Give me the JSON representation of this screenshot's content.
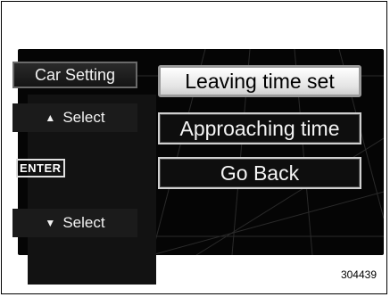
{
  "sidebar": {
    "title": "Car Setting",
    "select_up": "Select",
    "enter": "ENTER",
    "select_down": "Select"
  },
  "menu": {
    "items": [
      {
        "label": "Leaving time set",
        "state": "highlighted"
      },
      {
        "label": "Approaching time",
        "state": "normal"
      },
      {
        "label": "Go Back",
        "state": "normal"
      }
    ]
  },
  "figure_number": "304439",
  "icons": {
    "up": "up-triangle-icon",
    "down": "down-triangle-icon"
  },
  "colors": {
    "screen_bg": "#050505",
    "highlight_bg": "#ffffff",
    "text": "#f2f2f2"
  }
}
